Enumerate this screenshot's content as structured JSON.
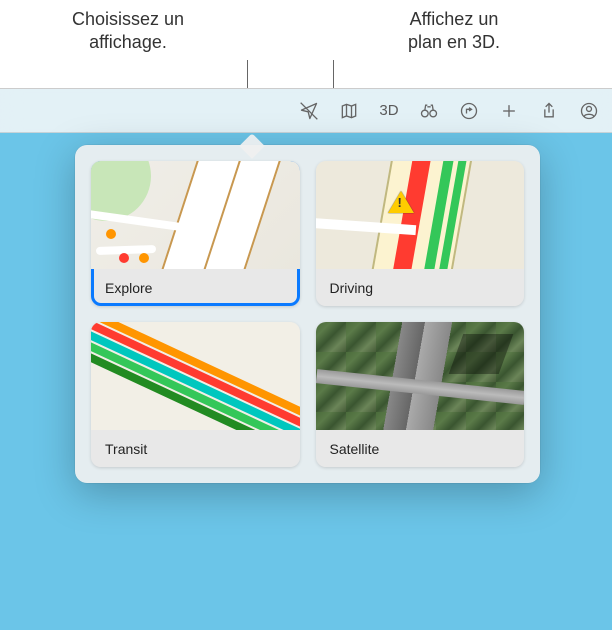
{
  "callouts": {
    "left": "Choisissez un\naffichage.",
    "right": "Affichez un\nplan en 3D."
  },
  "toolbar": {
    "location_icon": "location",
    "map_mode_icon": "map",
    "three_d_label": "3D",
    "look_around_icon": "binoculars",
    "directions_icon": "directions",
    "add_icon": "plus",
    "share_icon": "share",
    "account_icon": "account"
  },
  "map_modes": {
    "explore": {
      "label": "Explore",
      "selected": true
    },
    "driving": {
      "label": "Driving",
      "selected": false
    },
    "transit": {
      "label": "Transit",
      "selected": false
    },
    "satellite": {
      "label": "Satellite",
      "selected": false
    }
  }
}
